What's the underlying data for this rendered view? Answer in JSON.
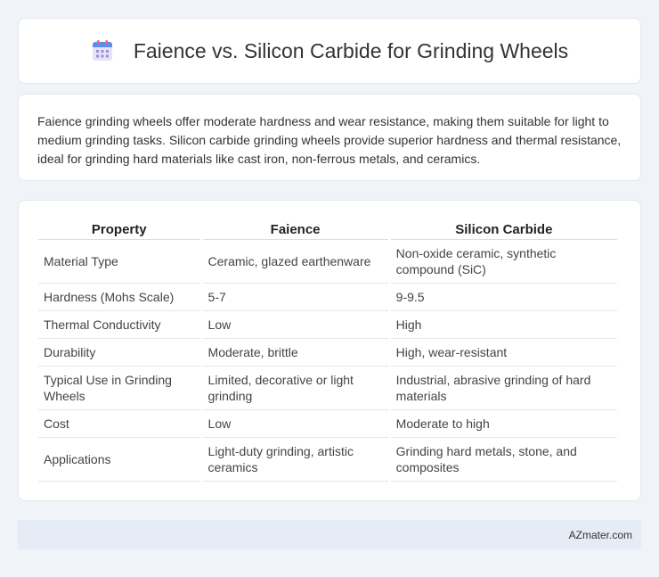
{
  "header": {
    "title": "Faience vs. Silicon Carbide for Grinding Wheels",
    "icon": "calendar-icon"
  },
  "summary": {
    "text": "Faience grinding wheels offer moderate hardness and wear resistance, making them suitable for light to medium grinding tasks. Silicon carbide grinding wheels provide superior hardness and thermal resistance, ideal for grinding hard materials like cast iron, non-ferrous metals, and ceramics."
  },
  "table": {
    "headers": [
      "Property",
      "Faience",
      "Silicon Carbide"
    ],
    "rows": [
      [
        "Material Type",
        "Ceramic, glazed earthenware",
        "Non-oxide ceramic, synthetic compound (SiC)"
      ],
      [
        "Hardness (Mohs Scale)",
        "5-7",
        "9-9.5"
      ],
      [
        "Thermal Conductivity",
        "Low",
        "High"
      ],
      [
        "Durability",
        "Moderate, brittle",
        "High, wear-resistant"
      ],
      [
        "Typical Use in Grinding Wheels",
        "Limited, decorative or light grinding",
        "Industrial, abrasive grinding of hard materials"
      ],
      [
        "Cost",
        "Low",
        "Moderate to high"
      ],
      [
        "Applications",
        "Light-duty grinding, artistic ceramics",
        "Grinding hard metals, stone, and composites"
      ]
    ]
  },
  "footer": {
    "text": "AZmater.com"
  }
}
